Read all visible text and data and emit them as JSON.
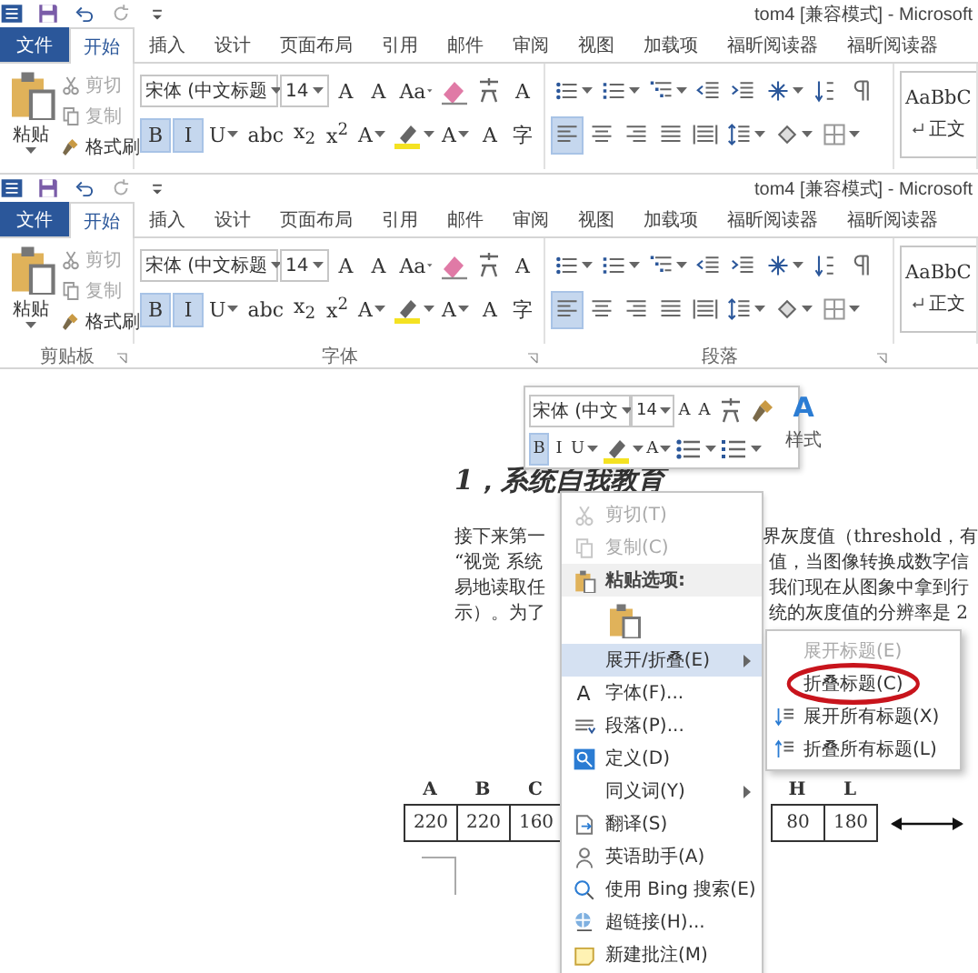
{
  "ribbons": [
    {
      "title": "tom4 [兼容模式] - Microsoft",
      "tabs": [
        {
          "label": "文件",
          "kind": "file",
          "selected": false
        },
        {
          "label": "开始",
          "kind": "tab",
          "selected": true
        },
        {
          "label": "插入",
          "kind": "tab",
          "selected": false
        },
        {
          "label": "设计",
          "kind": "tab",
          "selected": false
        },
        {
          "label": "页面布局",
          "kind": "tab",
          "selected": false
        },
        {
          "label": "引用",
          "kind": "tab",
          "selected": false
        },
        {
          "label": "邮件",
          "kind": "tab",
          "selected": false
        },
        {
          "label": "审阅",
          "kind": "tab",
          "selected": false
        },
        {
          "label": "视图",
          "kind": "tab",
          "selected": false
        },
        {
          "label": "加载项",
          "kind": "tab",
          "selected": false
        },
        {
          "label": "福昕阅读器",
          "kind": "tab",
          "selected": false
        },
        {
          "label": "福昕阅读器",
          "kind": "tab",
          "selected": false
        }
      ],
      "paste_label": "粘贴",
      "clipboard": [
        {
          "label": "剪切",
          "disabled": true
        },
        {
          "label": "复制",
          "disabled": true
        },
        {
          "label": "格式刷",
          "disabled": false
        }
      ],
      "font_name": "宋体 (中文标题",
      "font_size": "14",
      "font_row1": [
        {
          "kind": "grow",
          "label": "A"
        },
        {
          "kind": "shrink",
          "label": "A"
        },
        {
          "kind": "case",
          "label": "Aa"
        },
        {
          "kind": "clear"
        },
        {
          "kind": "phonetic"
        },
        {
          "kind": "border",
          "label": "A"
        }
      ],
      "font_row2": [
        {
          "kind": "bold",
          "label": "B",
          "selected": true
        },
        {
          "kind": "italic",
          "label": "I",
          "selected": true
        },
        {
          "kind": "underline",
          "label": "U",
          "selected": false
        },
        {
          "kind": "strike",
          "label": "abc",
          "selected": false
        },
        {
          "kind": "sub",
          "label": "x$_{2}$",
          "selected": false
        },
        {
          "kind": "sup",
          "label": "x$^{2}$",
          "selected": false
        },
        {
          "kind": "effect",
          "label": "A",
          "selected": false
        },
        {
          "kind": "highlight",
          "selected": false
        },
        {
          "kind": "color",
          "label": "A",
          "selected": false
        },
        {
          "kind": "shade",
          "label": "A",
          "selected": false
        },
        {
          "kind": "enclose",
          "label": "字",
          "selected": false
        }
      ],
      "align": [
        {
          "selected": true
        },
        {
          "selected": false
        },
        {
          "selected": false
        },
        {
          "selected": false
        },
        {
          "selected": false
        }
      ],
      "style_sample": "AaBbC",
      "style_name": "正文"
    },
    {
      "title": "tom4 [兼容模式] - Microsoft",
      "tabs": [
        {
          "label": "文件",
          "kind": "file",
          "selected": false
        },
        {
          "label": "开始",
          "kind": "tab",
          "selected": true
        },
        {
          "label": "插入",
          "kind": "tab",
          "selected": false
        },
        {
          "label": "设计",
          "kind": "tab",
          "selected": false
        },
        {
          "label": "页面布局",
          "kind": "tab",
          "selected": false
        },
        {
          "label": "引用",
          "kind": "tab",
          "selected": false
        },
        {
          "label": "邮件",
          "kind": "tab",
          "selected": false
        },
        {
          "label": "审阅",
          "kind": "tab",
          "selected": false
        },
        {
          "label": "视图",
          "kind": "tab",
          "selected": false
        },
        {
          "label": "加载项",
          "kind": "tab",
          "selected": false
        },
        {
          "label": "福昕阅读器",
          "kind": "tab",
          "selected": false
        },
        {
          "label": "福昕阅读器",
          "kind": "tab",
          "selected": false
        }
      ],
      "paste_label": "粘贴",
      "clipboard": [
        {
          "label": "剪切",
          "disabled": true
        },
        {
          "label": "复制",
          "disabled": true
        },
        {
          "label": "格式刷",
          "disabled": false
        }
      ],
      "font_name": "宋体 (中文标题",
      "font_size": "14",
      "font_row1": [
        {
          "kind": "grow",
          "label": "A"
        },
        {
          "kind": "shrink",
          "label": "A"
        },
        {
          "kind": "case",
          "label": "Aa"
        },
        {
          "kind": "clear"
        },
        {
          "kind": "phonetic"
        },
        {
          "kind": "border",
          "label": "A"
        }
      ],
      "font_row2": [
        {
          "kind": "bold",
          "label": "B",
          "selected": true
        },
        {
          "kind": "italic",
          "label": "I",
          "selected": true
        },
        {
          "kind": "underline",
          "label": "U",
          "selected": false
        },
        {
          "kind": "strike",
          "label": "abc",
          "selected": false
        },
        {
          "kind": "sub",
          "label": "x$_{2}$",
          "selected": false
        },
        {
          "kind": "sup",
          "label": "x$^{2}$",
          "selected": false
        },
        {
          "kind": "effect",
          "label": "A",
          "selected": false
        },
        {
          "kind": "highlight",
          "selected": false
        },
        {
          "kind": "color",
          "label": "A",
          "selected": false
        },
        {
          "kind": "shade",
          "label": "A",
          "selected": false
        },
        {
          "kind": "enclose",
          "label": "字",
          "selected": false
        }
      ],
      "align": [
        {
          "selected": true
        },
        {
          "selected": false
        },
        {
          "selected": false
        },
        {
          "selected": false
        },
        {
          "selected": false
        }
      ],
      "style_sample": "AaBbC",
      "style_name": "正文",
      "group_labels": [
        "剪贴板",
        "字体",
        "段落"
      ]
    }
  ],
  "doc": {
    "heading": "1，系统自我教育",
    "lines": [
      {
        "left": "接下来第一",
        "right": "界灰度值（threshold，有"
      },
      {
        "left": "“视觉 系统",
        "right": "值，当图像转换成数字信"
      },
      {
        "left": "易地读取任",
        "right": "我们现在从图象中拿到行"
      },
      {
        "left": "示）。为了",
        "right": "统的灰度值的分辨率是 2"
      }
    ],
    "table": {
      "left_headers": [
        "A",
        "B",
        "C"
      ],
      "right_headers": [
        "H",
        "L"
      ],
      "left_cells": [
        "220",
        "220",
        "160"
      ],
      "right_cells": [
        "80",
        "180"
      ]
    }
  },
  "mini_toolbar": {
    "font_name": "宋体 (中文",
    "font_size": "14",
    "row1": [
      {
        "kind": "grow",
        "label": "A"
      },
      {
        "kind": "shrink",
        "label": "A"
      },
      {
        "kind": "phonetic"
      },
      {
        "kind": "brush"
      }
    ],
    "styles_icon": "A",
    "row2": [
      {
        "kind": "bold",
        "label": "B",
        "selected": true
      },
      {
        "kind": "italic",
        "label": "I",
        "selected": false
      },
      {
        "kind": "underline",
        "label": "U",
        "selected": false
      },
      {
        "kind": "highlight",
        "selected": false
      },
      {
        "kind": "color",
        "label": "A",
        "selected": false
      },
      {
        "kind": "bullets",
        "selected": false
      },
      {
        "kind": "numbering",
        "selected": false
      }
    ],
    "styles_label": "样式"
  },
  "menu": {
    "items": [
      {
        "kind": "item",
        "label": "剪切(T)",
        "disabled": true,
        "highlighted": false,
        "submenu": false
      },
      {
        "kind": "item",
        "label": "复制(C)",
        "disabled": true,
        "highlighted": false,
        "submenu": false
      },
      {
        "kind": "header",
        "label": "粘贴选项:"
      },
      {
        "kind": "paste_options"
      },
      {
        "kind": "item",
        "label": "展开/折叠(E)",
        "disabled": false,
        "highlighted": true,
        "submenu": true
      },
      {
        "kind": "item",
        "label": "字体(F)...",
        "icon_text": "A",
        "disabled": false,
        "highlighted": false,
        "submenu": false
      },
      {
        "kind": "item",
        "label": "段落(P)...",
        "disabled": false,
        "highlighted": false,
        "submenu": false
      },
      {
        "kind": "item",
        "label": "定义(D)",
        "disabled": false,
        "highlighted": false,
        "submenu": false
      },
      {
        "kind": "item",
        "label": "同义词(Y)",
        "disabled": false,
        "highlighted": false,
        "submenu": true
      },
      {
        "kind": "item",
        "label": "翻译(S)",
        "disabled": false,
        "highlighted": false,
        "submenu": false
      },
      {
        "kind": "item",
        "label": "英语助手(A)",
        "disabled": false,
        "highlighted": false,
        "submenu": false
      },
      {
        "kind": "item",
        "label": "使用 Bing 搜索(E)",
        "disabled": false,
        "highlighted": false,
        "submenu": false
      },
      {
        "kind": "item",
        "label": "超链接(H)...",
        "disabled": false,
        "highlighted": false,
        "submenu": false
      },
      {
        "kind": "item",
        "label": "新建批注(M)",
        "disabled": false,
        "highlighted": false,
        "submenu": false
      }
    ]
  },
  "submenu": {
    "items": [
      {
        "label": "展开标题(E)",
        "disabled": true,
        "annotated": false
      },
      {
        "label": "折叠标题(C)",
        "disabled": false,
        "annotated": true
      },
      {
        "label": "展开所有标题(X)",
        "disabled": false,
        "annotated": false
      },
      {
        "label": "折叠所有标题(L)",
        "disabled": false,
        "annotated": false
      }
    ]
  }
}
